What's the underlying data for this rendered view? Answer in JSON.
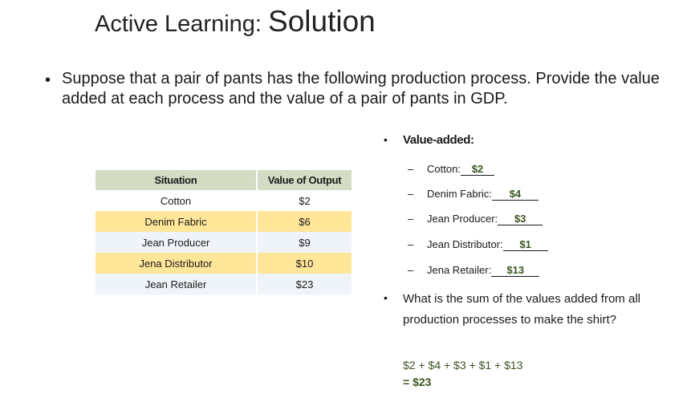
{
  "title": {
    "part1": "Active Learning: ",
    "part2": "Solution"
  },
  "main_bullet": "Suppose that a pair of pants has the following production process. Provide the value added at each process and the value of a pair of pants in GDP.",
  "table": {
    "headers": [
      "Situation",
      "Value of Output"
    ],
    "rows": [
      {
        "situation": "Cotton",
        "value": "$2"
      },
      {
        "situation": "Denim Fabric",
        "value": "$6"
      },
      {
        "situation": "Jean Producer",
        "value": "$9"
      },
      {
        "situation": "Jena Distributor",
        "value": "$10"
      },
      {
        "situation": "Jean Retailer",
        "value": "$23"
      }
    ]
  },
  "value_added": {
    "heading": "Value-added:",
    "items": [
      {
        "label": "Cotton:",
        "answer": "$2"
      },
      {
        "label": "Denim Fabric:",
        "answer": "$4"
      },
      {
        "label": "Jean Producer:",
        "answer": "$3"
      },
      {
        "label": "Jean Distributor:",
        "answer": "$1"
      },
      {
        "label": "Jena Retailer:",
        "answer": "$13"
      }
    ]
  },
  "question": "What is the sum of the values added from all production processes to make the shirt?",
  "sum": {
    "line1": "$2 + $4 + $3 + $1 + $13",
    "line2": "= $23"
  }
}
